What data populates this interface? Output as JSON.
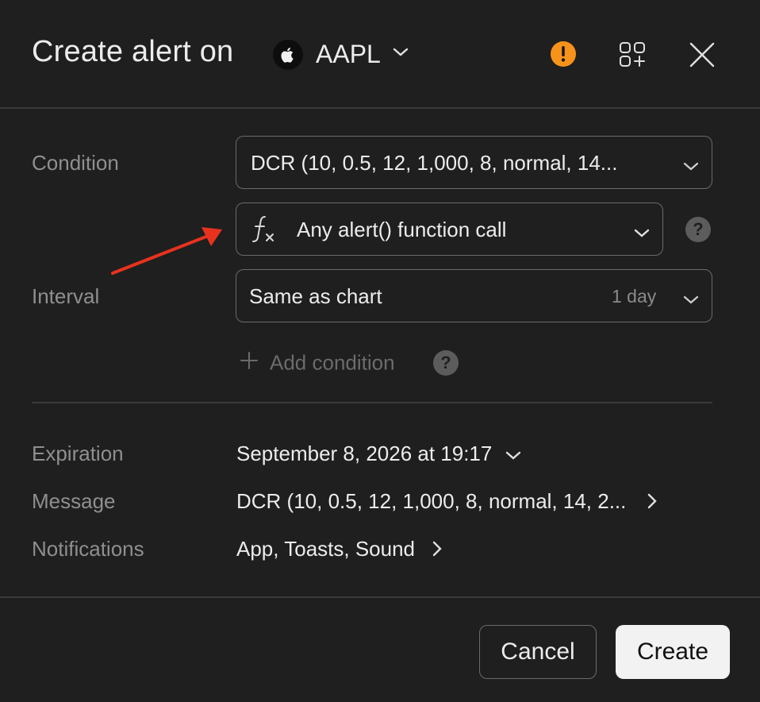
{
  "header": {
    "title": "Create alert on",
    "symbol": "AAPL",
    "icons": [
      "apple-logo-icon",
      "chevron-down-icon",
      "warning-icon",
      "add-widget-icon",
      "close-icon"
    ]
  },
  "form": {
    "condition_label": "Condition",
    "condition_value": "DCR (10, 0.5, 12, 1,000, 8, normal, 14...",
    "function_value": "Any alert() function call",
    "interval_label": "Interval",
    "interval_value": "Same as chart",
    "interval_hint": "1 day",
    "add_condition": "Add condition",
    "help_glyph": "?"
  },
  "details": {
    "expiration_label": "Expiration",
    "expiration_value": "September 8, 2026 at 19:17",
    "message_label": "Message",
    "message_value": "DCR (10, 0.5, 12, 1,000, 8, normal, 14, 2...",
    "notifications_label": "Notifications",
    "notifications_value": "App, Toasts, Sound"
  },
  "footer": {
    "cancel_label": "Cancel",
    "create_label": "Create"
  },
  "colors": {
    "background": "#1f1f1f",
    "warning": "#f7931a",
    "annotation_arrow": "#e8321e",
    "primary_button": "#f2f2f2"
  }
}
